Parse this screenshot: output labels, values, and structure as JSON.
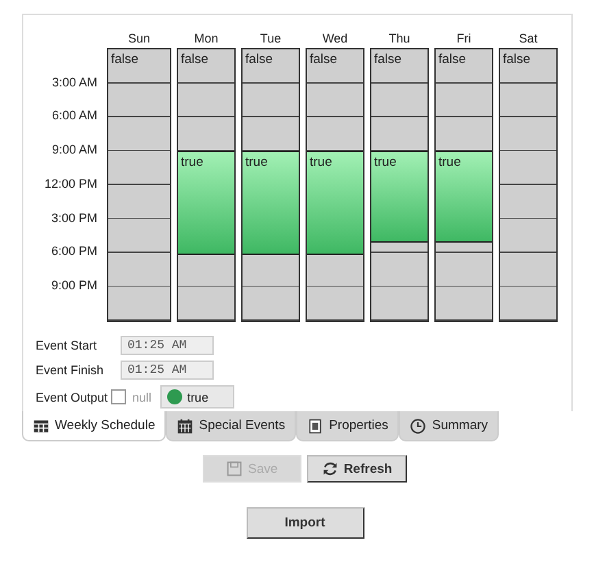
{
  "schedule": {
    "time_labels": [
      "3:00 AM",
      "6:00 AM",
      "9:00 AM",
      "12:00 PM",
      "3:00 PM",
      "6:00 PM",
      "9:00 PM"
    ],
    "days": [
      {
        "name": "Sun",
        "segments": [
          {
            "value": false,
            "label": "false"
          }
        ]
      },
      {
        "name": "Mon",
        "segments": [
          {
            "value": false,
            "label": "false"
          },
          {
            "value": true,
            "label": "true"
          },
          {
            "value": false
          }
        ]
      },
      {
        "name": "Tue",
        "segments": [
          {
            "value": false,
            "label": "false"
          },
          {
            "value": true,
            "label": "true"
          },
          {
            "value": false
          }
        ]
      },
      {
        "name": "Wed",
        "segments": [
          {
            "value": false,
            "label": "false"
          },
          {
            "value": true,
            "label": "true"
          },
          {
            "value": false
          }
        ]
      },
      {
        "name": "Thu",
        "segments": [
          {
            "value": false,
            "label": "false"
          },
          {
            "value": true,
            "label": "true"
          },
          {
            "value": false
          }
        ]
      },
      {
        "name": "Fri",
        "segments": [
          {
            "value": false,
            "label": "false"
          },
          {
            "value": true,
            "label": "true"
          },
          {
            "value": false
          }
        ]
      },
      {
        "name": "Sat",
        "segments": [
          {
            "value": false,
            "label": "false"
          }
        ]
      }
    ]
  },
  "event": {
    "fields": [
      {
        "label": "Event Start",
        "value": "01:25 AM"
      },
      {
        "label": "Event Finish",
        "value": "01:25 AM"
      }
    ],
    "output": {
      "label": "Event Output",
      "checked": false,
      "null_label": "null",
      "value": "true",
      "on": true
    }
  },
  "tabs": [
    {
      "label": "Weekly Schedule",
      "selected": true
    },
    {
      "label": "Special Events",
      "selected": false
    },
    {
      "label": "Properties",
      "selected": false
    },
    {
      "label": "Summary",
      "selected": false
    }
  ],
  "buttons": [
    [
      {
        "label": "Save",
        "disabled": true
      },
      {
        "label": "Refresh",
        "disabled": false
      }
    ],
    [
      {
        "label": "Import",
        "disabled": false
      }
    ]
  ]
}
